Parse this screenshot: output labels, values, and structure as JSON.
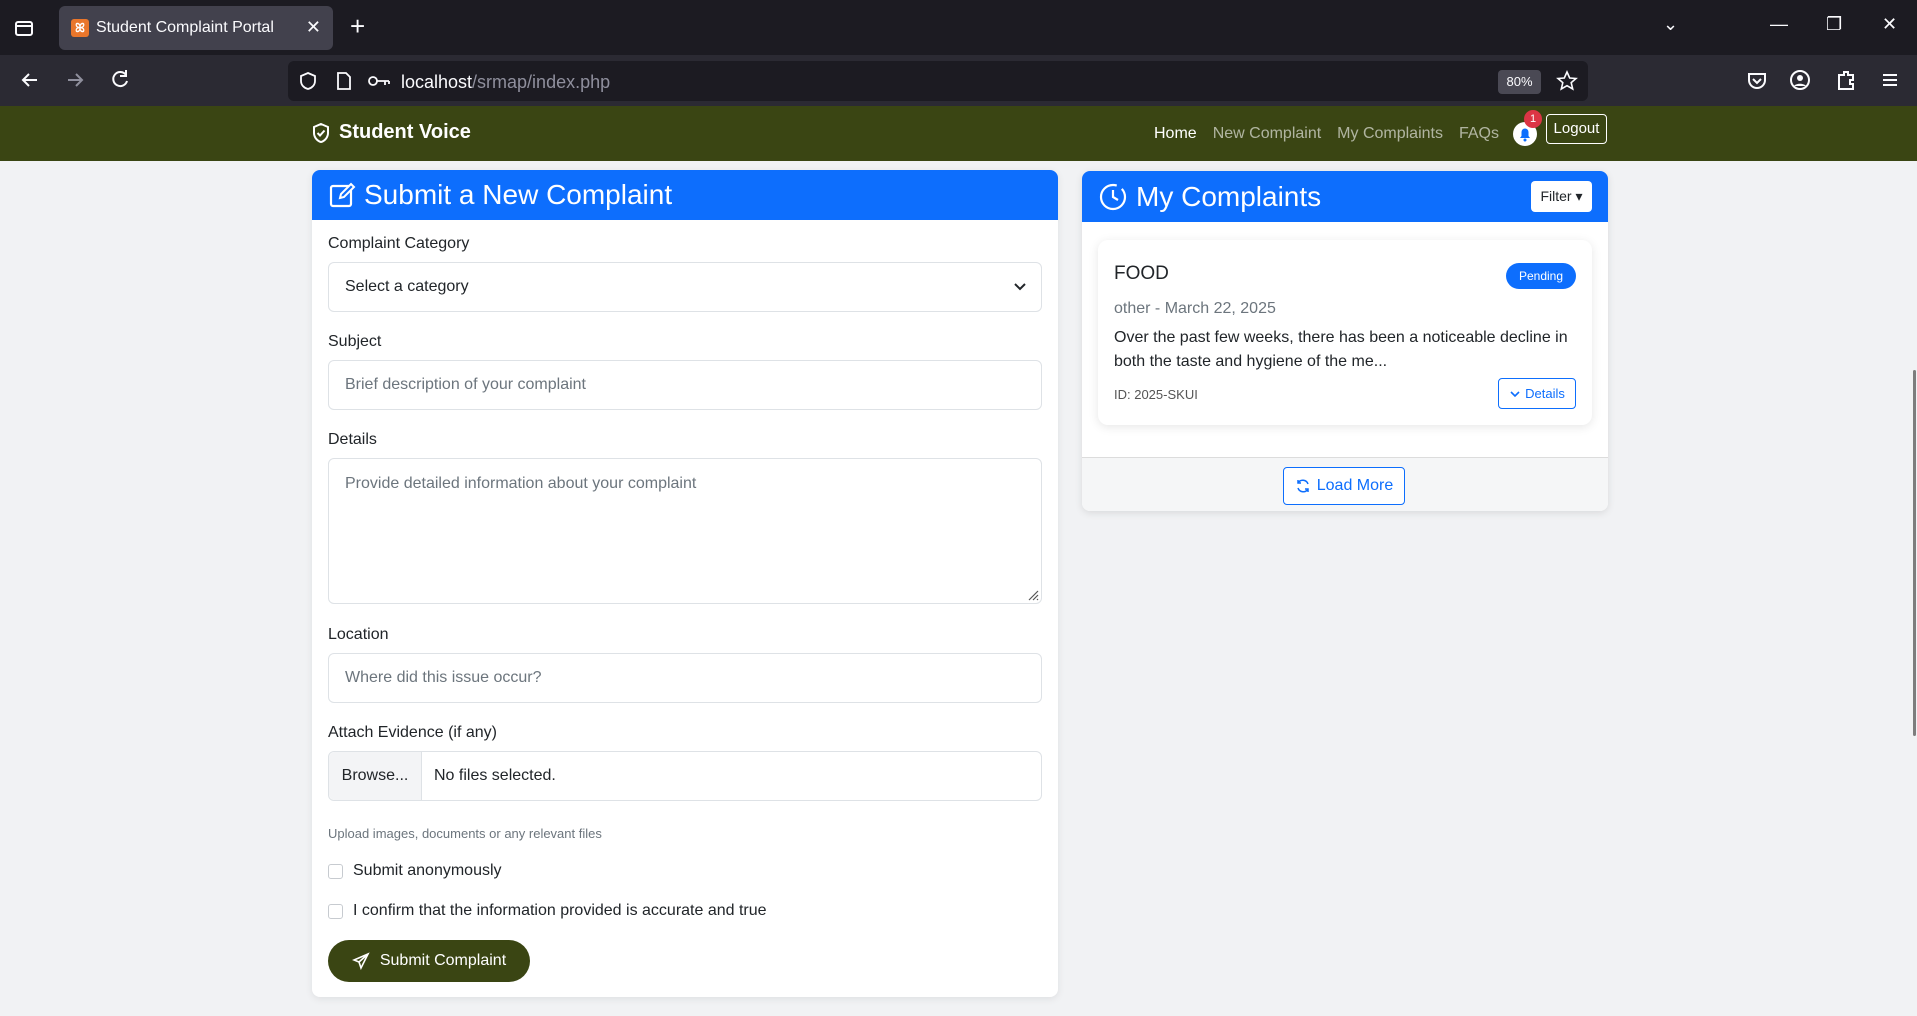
{
  "browser": {
    "tab_title": "Student Complaint Portal",
    "tab_favicon_glyph": "ꕤ",
    "url_host": "localhost",
    "url_path": "/srmap/index.php",
    "zoom": "80%"
  },
  "site": {
    "brand": "Student Voice",
    "nav": [
      "Home",
      "New Complaint",
      "My Complaints",
      "FAQs"
    ],
    "notification_count": "1",
    "logout_label": "Logout"
  },
  "form": {
    "title": "Submit a New Complaint",
    "category_label": "Complaint Category",
    "category_value": "Select a category",
    "subject_label": "Subject",
    "subject_placeholder": "Brief description of your complaint",
    "details_label": "Details",
    "details_placeholder": "Provide detailed information about your complaint",
    "location_label": "Location",
    "location_placeholder": "Where did this issue occur?",
    "evidence_label": "Attach Evidence (if any)",
    "browse_label": "Browse...",
    "file_status": "No files selected.",
    "help_text": "Upload images, documents or any relevant files",
    "anonymous_label": "Submit anonymously",
    "confirm_label": "I confirm that the information provided is accurate and true",
    "submit_label": "Submit Complaint"
  },
  "complaints": {
    "title": "My Complaints",
    "filter_label": "Filter",
    "items": [
      {
        "title": "FOOD",
        "status": "Pending",
        "meta": "other - March 22, 2025",
        "description": "Over the past few weeks, there has been a noticeable decline in both the taste and hygiene of the me...",
        "id": "ID: 2025-SKUI",
        "details_label": "Details"
      }
    ],
    "load_more_label": "Load More"
  },
  "colors": {
    "primary": "#0d6efd",
    "header_green": "#3a4513",
    "danger": "#dc3545"
  }
}
